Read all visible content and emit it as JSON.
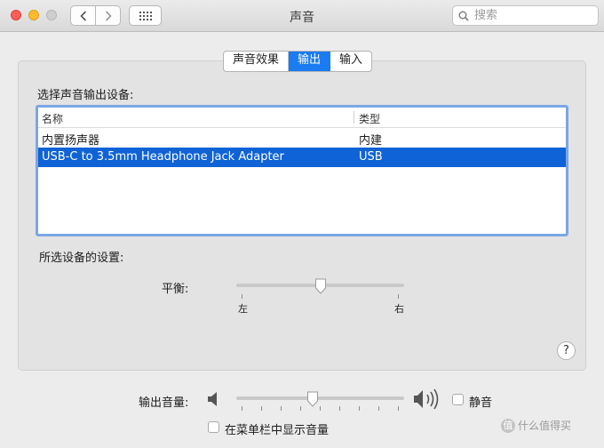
{
  "window": {
    "title": "声音"
  },
  "search": {
    "placeholder": "搜索"
  },
  "tabs": [
    {
      "label": "声音效果",
      "active": false
    },
    {
      "label": "输出",
      "active": true
    },
    {
      "label": "输入",
      "active": false
    }
  ],
  "output": {
    "select_label": "选择声音输出设备:",
    "columns": [
      "名称",
      "类型"
    ],
    "devices": [
      {
        "name": "内置扬声器",
        "type": "内建",
        "selected": false
      },
      {
        "name": "USB-C to 3.5mm Headphone Jack Adapter",
        "type": "USB",
        "selected": true
      }
    ],
    "settings_label": "所选设备的设置:",
    "balance": {
      "label": "平衡:",
      "left": "左",
      "right": "右",
      "value": 0.5
    }
  },
  "volume": {
    "label": "输出音量:",
    "value": 0.45,
    "mute_label": "静音",
    "muted": false
  },
  "menubar": {
    "label": "在菜单栏中显示音量",
    "checked": false
  },
  "help": {
    "label": "?"
  },
  "watermark": {
    "badge": "值",
    "text": "什么值得买"
  },
  "colors": {
    "accent": "#1a7bf2",
    "selection": "#0f63d6"
  }
}
